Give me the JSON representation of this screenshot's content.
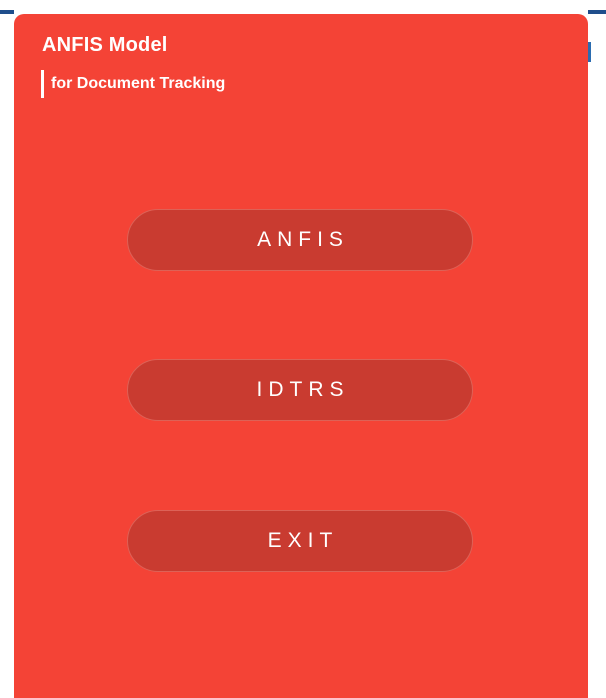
{
  "app": {
    "title": "ANFIS Model",
    "subtitle": "for Document Tracking"
  },
  "menu": {
    "buttons": [
      {
        "label": "ANFIS"
      },
      {
        "label": "IDTRS"
      },
      {
        "label": "EXIT"
      }
    ]
  },
  "colors": {
    "panel": "#f44336",
    "button": "#c93b30",
    "text": "#ffffff"
  }
}
